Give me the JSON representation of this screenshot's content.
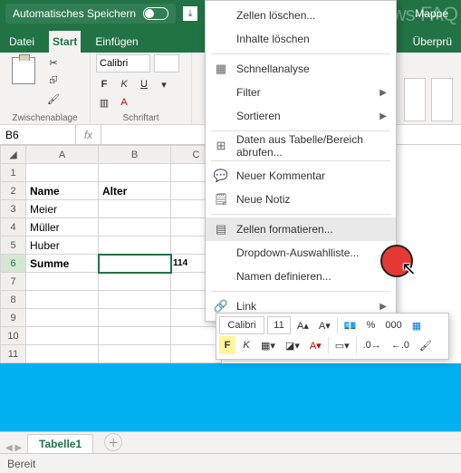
{
  "watermark": "Windows-FAQ",
  "titlebar": {
    "autosave_label": "Automatisches Speichern",
    "file": "Mappe"
  },
  "ribbon": {
    "tabs": [
      "Datei",
      "Start",
      "Einfügen",
      "Überprü"
    ],
    "groups": {
      "clipboard": "Zwischenablage",
      "font": "Schriftart"
    },
    "font": {
      "name": "Calibri",
      "size_blank": ""
    }
  },
  "formula": {
    "cell": "B6"
  },
  "grid": {
    "cols": [
      "A",
      "B",
      "C"
    ],
    "rowhdr": [
      "1",
      "2",
      "3",
      "4",
      "5",
      "6",
      "7",
      "8",
      "9",
      "10",
      "11"
    ],
    "data": [
      [
        "Name",
        "Alter",
        ""
      ],
      [
        "Meier",
        "",
        ""
      ],
      [
        "Müller",
        "",
        ""
      ],
      [
        "Huber",
        "",
        ""
      ],
      [
        "Summe",
        "",
        "114"
      ]
    ]
  },
  "context": {
    "items": [
      {
        "label": "Zellen löschen..."
      },
      {
        "label": "Inhalte löschen"
      },
      {
        "label": "Schnellanalyse"
      },
      {
        "label": "Filter"
      },
      {
        "label": "Sortieren"
      },
      {
        "label": "Daten aus Tabelle/Bereich abrufen..."
      },
      {
        "label": "Neuer Kommentar"
      },
      {
        "label": "Neue Notiz"
      },
      {
        "label": "Zellen formatieren..."
      },
      {
        "label": "Dropdown-Auswahlliste..."
      },
      {
        "label": "Namen definieren..."
      },
      {
        "label": "Link"
      }
    ]
  },
  "mini": {
    "font": "Calibri",
    "size": "11"
  },
  "sheets": {
    "active": "Tabelle1"
  },
  "status": {
    "text": "Bereit"
  }
}
